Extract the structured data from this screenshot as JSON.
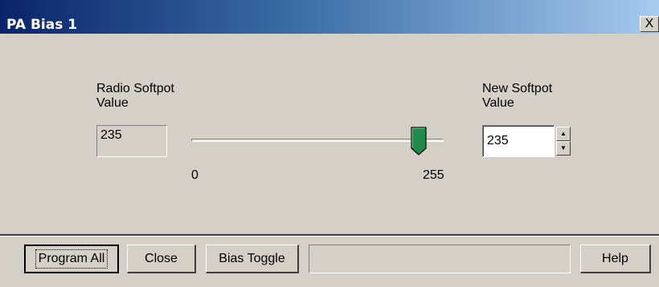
{
  "window": {
    "title": "PA Bias 1",
    "close_label": "X"
  },
  "radio_softpot": {
    "label_line1": "Radio Softpot",
    "label_line2": "Value",
    "value": "235"
  },
  "slider": {
    "min_label": "0",
    "max_label": "255",
    "min": 0,
    "max": 255,
    "value": 235,
    "thumb_color": "#1f8a4c"
  },
  "new_softpot": {
    "label_line1": "New Softpot",
    "label_line2": "Value",
    "value": "235",
    "spin_up_icon": "arrow-up-icon",
    "spin_down_icon": "arrow-down-icon"
  },
  "buttons": {
    "program_all": "Program All",
    "close": "Close",
    "bias_toggle": "Bias Toggle",
    "help": "Help"
  },
  "status": {
    "text": ""
  }
}
